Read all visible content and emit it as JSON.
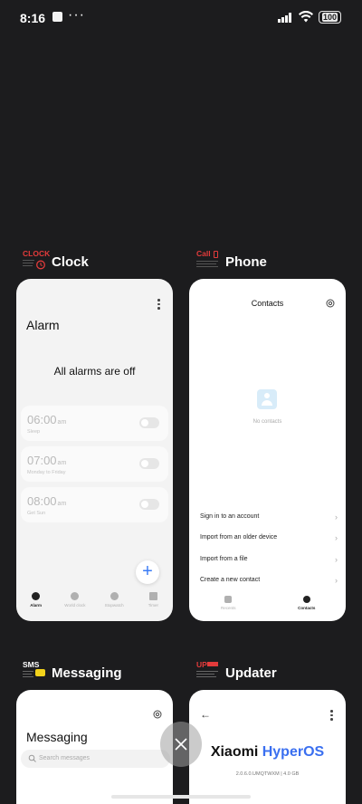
{
  "status_bar": {
    "time": "8:16",
    "battery": "100"
  },
  "apps": {
    "clock": {
      "name": "Clock",
      "icon_text": "CLOCK",
      "screen_title": "Alarm",
      "status_message": "All alarms are off",
      "alarms": [
        {
          "time": "06:00",
          "period": "am",
          "label": "Sleep"
        },
        {
          "time": "07:00",
          "period": "am",
          "label": "Monday to Friday"
        },
        {
          "time": "08:00",
          "period": "am",
          "label": "Get Sun"
        }
      ],
      "nav": [
        {
          "label": "Alarm",
          "icon": "alarm-icon"
        },
        {
          "label": "World clock",
          "icon": "world-clock-icon"
        },
        {
          "label": "Stopwatch",
          "icon": "stopwatch-icon"
        },
        {
          "label": "Timer",
          "icon": "timer-icon"
        }
      ],
      "add_label": "+"
    },
    "phone": {
      "name": "Phone",
      "icon_text": "Call",
      "screen_title": "Contacts",
      "empty_message": "No contacts",
      "options": [
        "Sign in to an account",
        "Import from an older device",
        "Import from a file",
        "Create a new contact"
      ],
      "nav": [
        {
          "label": "Recents",
          "icon": "phone-icon"
        },
        {
          "label": "Contacts",
          "icon": "person-icon"
        }
      ]
    },
    "messaging": {
      "name": "Messaging",
      "icon_text": "SMS",
      "screen_title": "Messaging",
      "search_placeholder": "Search messages"
    },
    "updater": {
      "name": "Updater",
      "icon_text": "UP",
      "brand_text": "Xiaomi ",
      "brand_accent": "HyperOS",
      "version": "2.0.6.0.UMQTWXM | 4.0 GB"
    }
  },
  "colors": {
    "background": "#1c1c1e",
    "accent_blue": "#3a7bf5",
    "icon_red": "#e23b3b"
  }
}
